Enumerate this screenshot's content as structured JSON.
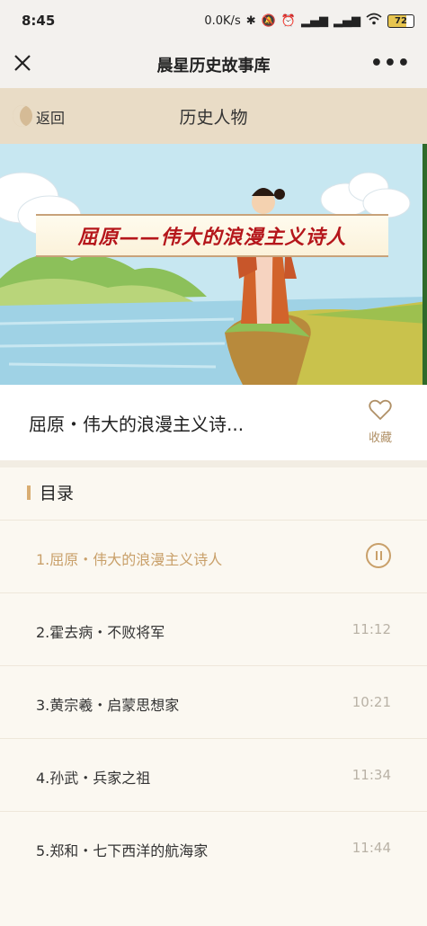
{
  "status_bar": {
    "time": "8:45",
    "net_speed": "0.0K/s",
    "battery": "72"
  },
  "title_bar": {
    "title": "晨星历史故事库",
    "close_icon": "close-icon",
    "more_icon": "more-icon"
  },
  "nav": {
    "back_label": "返回",
    "section_title": "历史人物"
  },
  "hero": {
    "banner_text": "屈原——伟大的浪漫主义诗人"
  },
  "story": {
    "title": "屈原・伟大的浪漫主义诗...",
    "favorite_label": "收藏",
    "favorite_icon": "heart-icon"
  },
  "toc": {
    "title": "目录",
    "items": [
      {
        "label": "1.屈原・伟大的浪漫主义诗人",
        "duration": "",
        "active": true
      },
      {
        "label": "2.霍去病・不败将军",
        "duration": "11:12"
      },
      {
        "label": "3.黄宗羲・启蒙思想家",
        "duration": "10:21"
      },
      {
        "label": "4.孙武・兵家之祖",
        "duration": "11:34"
      },
      {
        "label": "5.郑和・七下西洋的航海家",
        "duration": "11:44"
      }
    ]
  },
  "colors": {
    "accent": "#c9a06a",
    "nav_bg": "#e9dcc6",
    "banner_text": "#b5161b"
  }
}
